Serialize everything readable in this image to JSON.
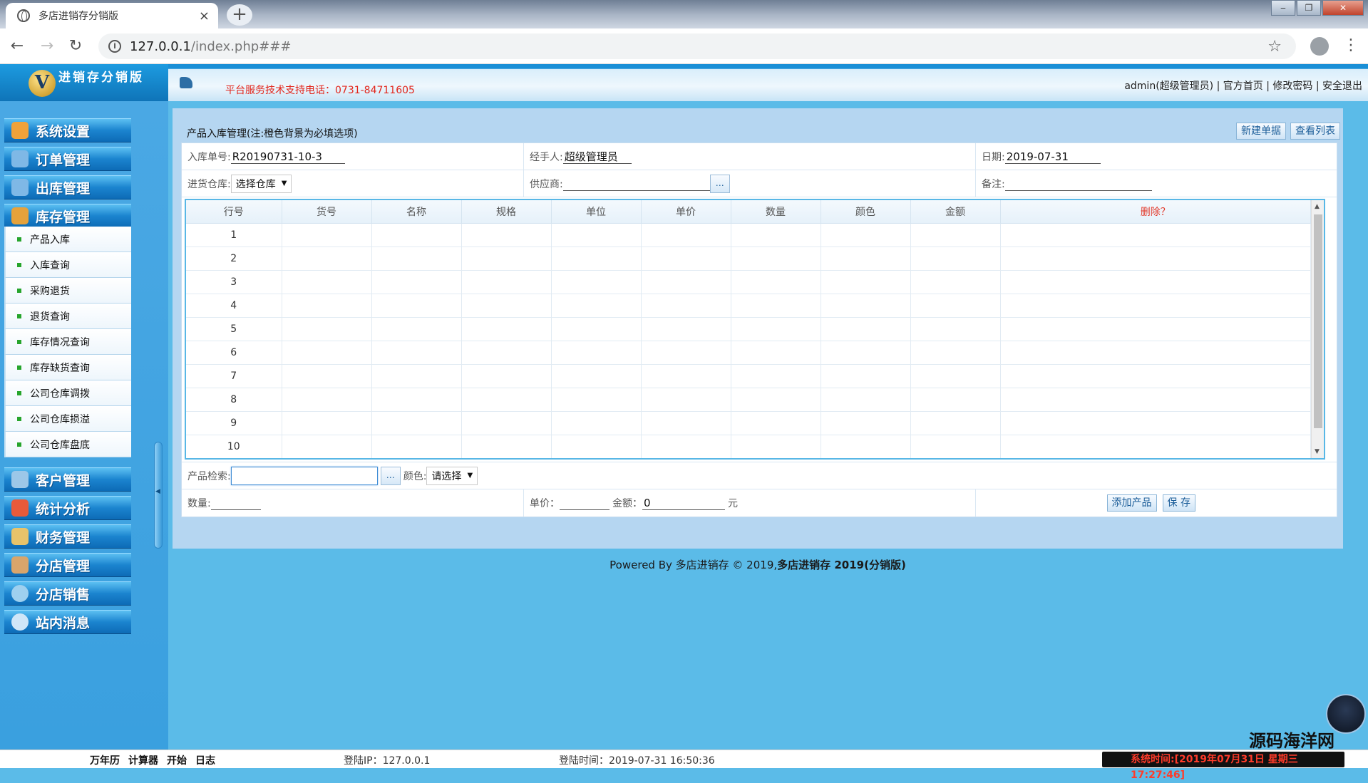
{
  "browser": {
    "tab_title": "多店进销存分销版",
    "tab_close": "×",
    "new_tab": "+",
    "url_host": "127.0.0.1",
    "url_path": "/index.php###",
    "window_buttons": [
      "‒",
      "❐",
      "✕"
    ]
  },
  "header": {
    "logo_letter": "V",
    "logo_name": "进销存分销版",
    "support_text": "平台服务技术支持电话：0731-84711605",
    "user": "admin(超级管理员)",
    "links": [
      "官方首页",
      "修改密码",
      "安全退出"
    ],
    "separator": " | "
  },
  "sidebar": {
    "menus_top": [
      {
        "label": "系统设置",
        "icon": "wrench-icon",
        "color": "#f0a23a"
      },
      {
        "label": "订单管理",
        "icon": "monitor-icon",
        "color": "#7fb8e6"
      },
      {
        "label": "出库管理",
        "icon": "monitor-icon",
        "color": "#7fb8e6"
      },
      {
        "label": "库存管理",
        "icon": "box-icon",
        "color": "#e6a23b"
      }
    ],
    "submenu": [
      "产品入库",
      "入库查询",
      "采购退货",
      "退货查询",
      "库存情况查询",
      "库存缺货查询",
      "公司仓库调拨",
      "公司仓库损溢",
      "公司仓库盘底"
    ],
    "menus_bottom": [
      {
        "label": "客户管理",
        "icon": "document-icon",
        "color": "#9cc7e8"
      },
      {
        "label": "统计分析",
        "icon": "bar-chart-icon",
        "color": "#e85a3a"
      },
      {
        "label": "财务管理",
        "icon": "money-icon",
        "color": "#e8c36a"
      },
      {
        "label": "分店管理",
        "icon": "person-icon",
        "color": "#d9a56b"
      },
      {
        "label": "分店销售",
        "icon": "gear-icon",
        "color": "#9ed0ef"
      },
      {
        "label": "站内消息",
        "icon": "info-icon",
        "color": "#cfe6f8"
      }
    ]
  },
  "main": {
    "title": "产品入库管理(注:橙色背景为必填选项)",
    "btn_new": "新建单据",
    "btn_list": "查看列表",
    "form": {
      "order_no_label": "入库单号:",
      "order_no": "R20190731-10-3",
      "handler_label": "经手人:",
      "handler": "超级管理员",
      "date_label": "日期:",
      "date": "2019-07-31",
      "warehouse_label": "进货仓库:",
      "warehouse_value": "选择仓库",
      "supplier_label": "供应商:",
      "supplier_value": "",
      "remark_label": "备注:",
      "remark_value": "",
      "dots": "…"
    },
    "grid": {
      "headers": [
        "行号",
        "货号",
        "名称",
        "规格",
        "单位",
        "单价",
        "数量",
        "颜色",
        "金额",
        "删除？"
      ],
      "rows": [
        "1",
        "2",
        "3",
        "4",
        "5",
        "6",
        "7",
        "8",
        "9",
        "10"
      ]
    },
    "search": {
      "label": "产品检索:",
      "value": "",
      "color_label": "颜色:",
      "color_value": "请选择"
    },
    "bottom": {
      "qty_label": "数量:",
      "qty_value": "",
      "price_label": "单价：",
      "price_value": "",
      "amount_label": "金额：",
      "amount_value": "0",
      "unit": "元",
      "btn_add": "添加产品",
      "btn_save": "保 存"
    }
  },
  "footer": {
    "prefix": "Powered By 多店进销存 © 2019,",
    "product": "多店进销存 2019(分销版)"
  },
  "statusbar": {
    "tools": [
      "万年历",
      "计算器",
      "开始",
      "日志"
    ],
    "login_ip": "登陆IP：127.0.0.1",
    "login_time": "登陆时间：2019-07-31 16:50:36",
    "system_time": "系统时间:[2019年07月31日 星期三 17:27:46]"
  },
  "watermark": "源码海洋网"
}
